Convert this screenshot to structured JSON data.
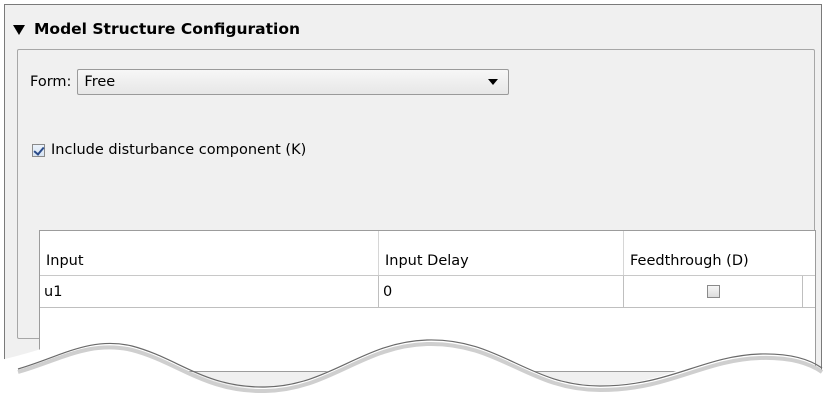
{
  "panel": {
    "title": "Model Structure Configuration"
  },
  "form": {
    "label": "Form:",
    "selected": "Free"
  },
  "disturbance": {
    "label": "Include disturbance component (K)",
    "checked": true
  },
  "table": {
    "columns": [
      "Input",
      "Input Delay",
      "Feedthrough (D)"
    ],
    "rows": [
      {
        "input": "u1",
        "delay": "0",
        "feedthrough": false
      }
    ]
  },
  "icons": {
    "collapse": "triangle-down-icon",
    "dropdown": "chevron-down-icon"
  },
  "colors": {
    "panel_bg": "#f0f0f0",
    "table_bg": "#ffffff",
    "border": "#9c9c9c"
  }
}
